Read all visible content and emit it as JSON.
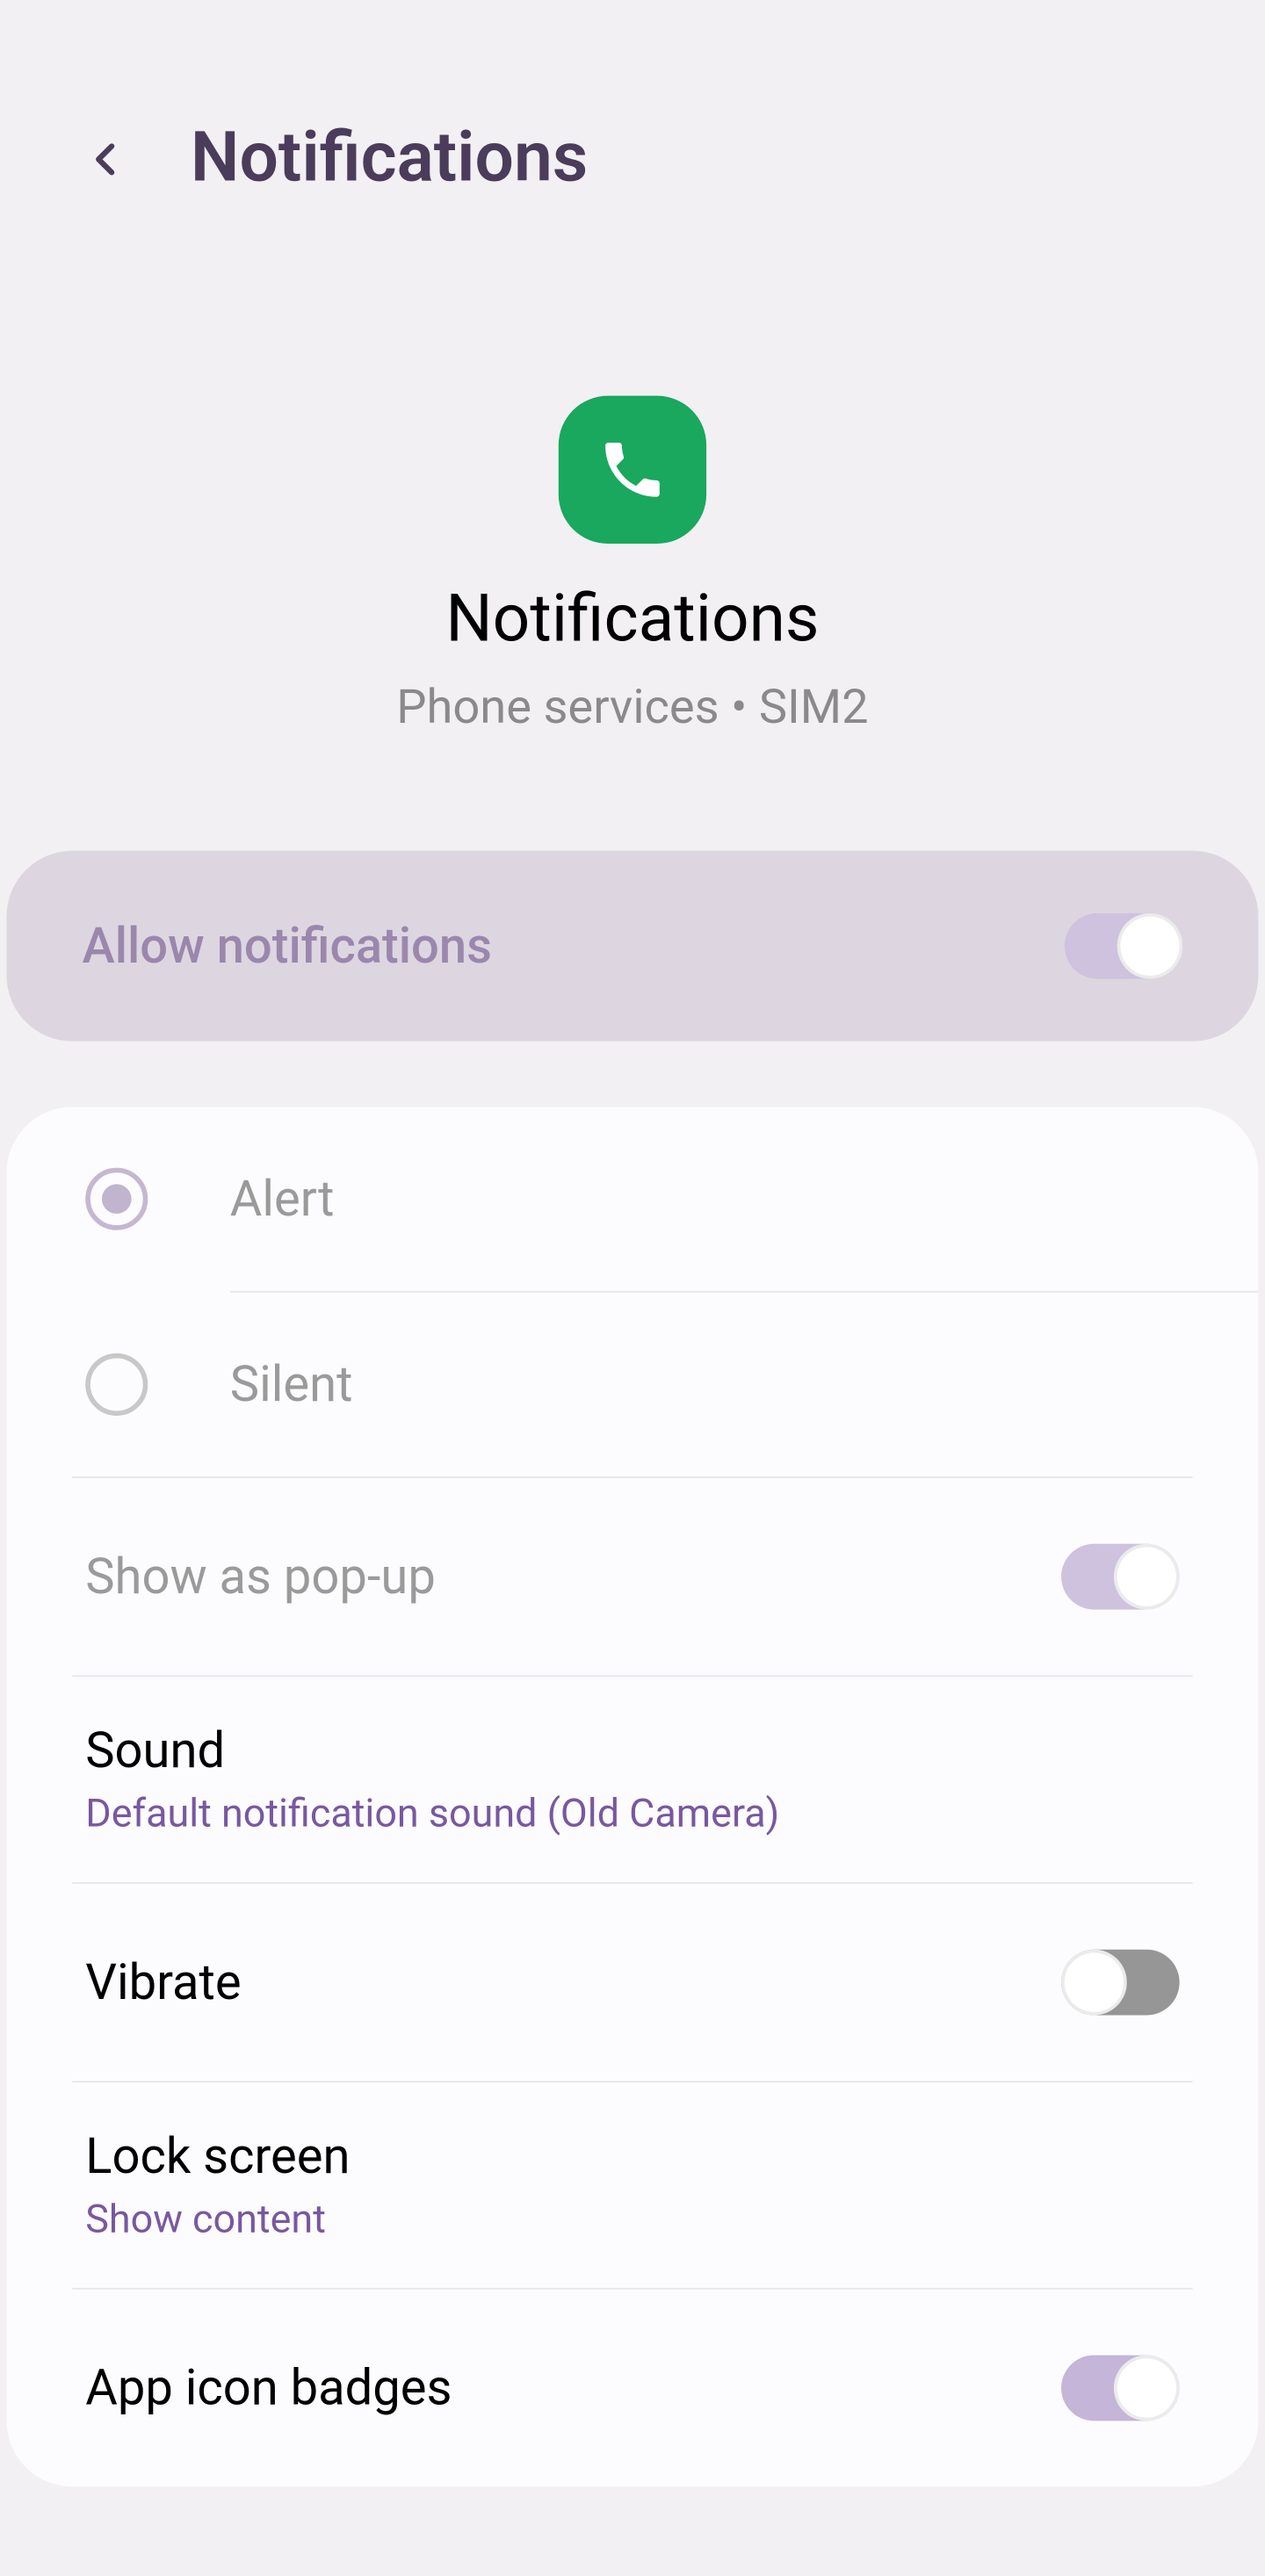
{
  "header": {
    "title": "Notifications"
  },
  "app": {
    "title": "Notifications",
    "subtitle": "Phone services • SIM2",
    "iconColor": "#1aa75e"
  },
  "allow": {
    "label": "Allow notifications",
    "enabled": true
  },
  "mode": {
    "alert": "Alert",
    "silent": "Silent",
    "selected": "alert"
  },
  "settings": {
    "popup": {
      "label": "Show as pop-up",
      "enabled": true
    },
    "sound": {
      "label": "Sound",
      "value": "Default notification sound (Old Camera)"
    },
    "vibrate": {
      "label": "Vibrate",
      "enabled": false
    },
    "lockscreen": {
      "label": "Lock screen",
      "value": "Show content"
    },
    "badges": {
      "label": "App icon badges",
      "enabled": true
    }
  }
}
